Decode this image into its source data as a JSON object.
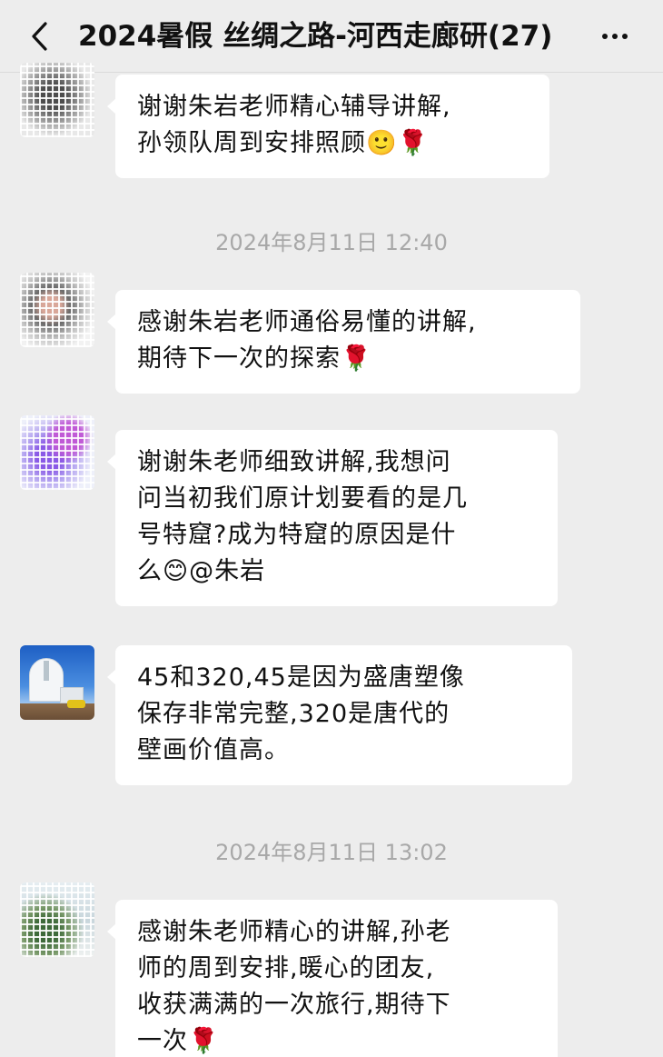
{
  "header": {
    "back_icon": "chevron-left-icon",
    "title": "2024暑假 丝绸之路-河西走廊研(27)",
    "more_icon": "more-dots-icon"
  },
  "messages": [
    {
      "text": "谢谢朱岩老师精心辅导讲解,\n孙领队周到安排照顾🙂🌹"
    },
    {
      "timestamp": "2024年8月11日 12:40"
    },
    {
      "text": "感谢朱岩老师通俗易懂的讲解,\n期待下一次的探索🌹"
    },
    {
      "text": "谢谢朱老师细致讲解,我想问\n问当初我们原计划要看的是几\n号特窟?成为特窟的原因是什\n么😊@朱岩"
    },
    {
      "text": "45和320,45是因为盛唐塑像\n保存非常完整,320是唐代的\n壁画价值高。"
    },
    {
      "timestamp": "2024年8月11日 13:02"
    },
    {
      "text": "感谢朱老师精心的讲解,孙老\n师的周到安排,暖心的团友,\n收获满满的一次旅行,期待下\n一次🌹"
    }
  ]
}
